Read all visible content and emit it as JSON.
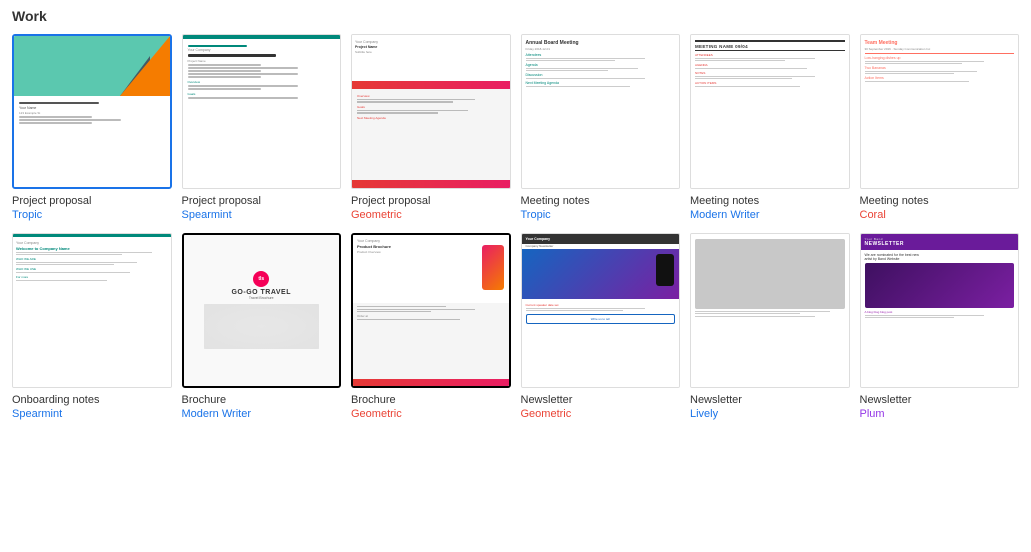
{
  "section": {
    "title": "Work"
  },
  "templates": [
    {
      "id": "project-proposal-tropic",
      "name": "Project proposal",
      "style": "Tropic",
      "style_class": "style-tropic",
      "selected": true,
      "selected_class": "selected",
      "thumb_type": "tropic-proposal"
    },
    {
      "id": "project-proposal-spearmint",
      "name": "Project proposal",
      "style": "Spearmint",
      "style_class": "style-spearmint",
      "selected": false,
      "selected_class": "",
      "thumb_type": "spearmint-proposal"
    },
    {
      "id": "project-proposal-geometric",
      "name": "Project proposal",
      "style": "Geometric",
      "style_class": "style-geometric",
      "selected": false,
      "selected_class": "",
      "thumb_type": "geometric-proposal"
    },
    {
      "id": "meeting-notes-tropic",
      "name": "Meeting notes",
      "style": "Tropic",
      "style_class": "style-tropic",
      "selected": false,
      "selected_class": "",
      "thumb_type": "meeting-tropic"
    },
    {
      "id": "meeting-notes-modern-writer",
      "name": "Meeting notes",
      "style": "Modern Writer",
      "style_class": "style-modern-writer",
      "selected": false,
      "selected_class": "",
      "thumb_type": "meeting-modern"
    },
    {
      "id": "meeting-notes-coral",
      "name": "Meeting notes",
      "style": "Coral",
      "style_class": "style-coral",
      "selected": false,
      "selected_class": "",
      "thumb_type": "meeting-coral"
    },
    {
      "id": "onboarding-notes-spearmint",
      "name": "Onboarding notes",
      "style": "Spearmint",
      "style_class": "style-spearmint",
      "selected": false,
      "selected_class": "",
      "thumb_type": "onboarding-spearmint"
    },
    {
      "id": "brochure-modern-writer",
      "name": "Brochure",
      "style": "Modern Writer",
      "style_class": "style-modern-writer",
      "selected": false,
      "selected_class": "selected-black",
      "thumb_type": "brochure-modern"
    },
    {
      "id": "brochure-geometric",
      "name": "Brochure",
      "style": "Geometric",
      "style_class": "style-geometric",
      "selected": false,
      "selected_class": "selected-black",
      "thumb_type": "brochure-geo"
    },
    {
      "id": "newsletter-geometric",
      "name": "Newsletter",
      "style": "Geometric",
      "style_class": "style-geometric",
      "selected": false,
      "selected_class": "",
      "thumb_type": "newsletter-geo"
    },
    {
      "id": "newsletter-lively",
      "name": "Newsletter",
      "style": "Lively",
      "style_class": "style-lively",
      "selected": false,
      "selected_class": "",
      "thumb_type": "newsletter-lively"
    },
    {
      "id": "newsletter-plum",
      "name": "Newsletter",
      "style": "Plum",
      "style_class": "style-plum",
      "selected": false,
      "selected_class": "",
      "thumb_type": "newsletter-plum"
    }
  ]
}
